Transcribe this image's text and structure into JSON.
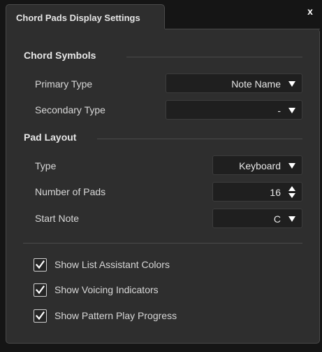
{
  "dialog": {
    "tab_title": "Chord Pads Display Settings",
    "close_label": "x"
  },
  "chord_symbols": {
    "heading": "Chord Symbols",
    "primary_type": {
      "label": "Primary Type",
      "value": "Note Name"
    },
    "secondary_type": {
      "label": "Secondary Type",
      "value": "-"
    }
  },
  "pad_layout": {
    "heading": "Pad Layout",
    "type": {
      "label": "Type",
      "value": "Keyboard"
    },
    "number_of_pads": {
      "label": "Number of Pads",
      "value": "16"
    },
    "start_note": {
      "label": "Start Note",
      "value": "C"
    }
  },
  "options": [
    {
      "label": "Show List Assistant Colors",
      "checked": true
    },
    {
      "label": "Show Voicing Indicators",
      "checked": true
    },
    {
      "label": "Show Pattern Play Progress",
      "checked": true
    }
  ],
  "colors": {
    "background": "#151515",
    "panel": "#2e2e2e",
    "field": "#1f1f1f",
    "border": "#4a4a4a",
    "text": "#d8d8d8"
  }
}
